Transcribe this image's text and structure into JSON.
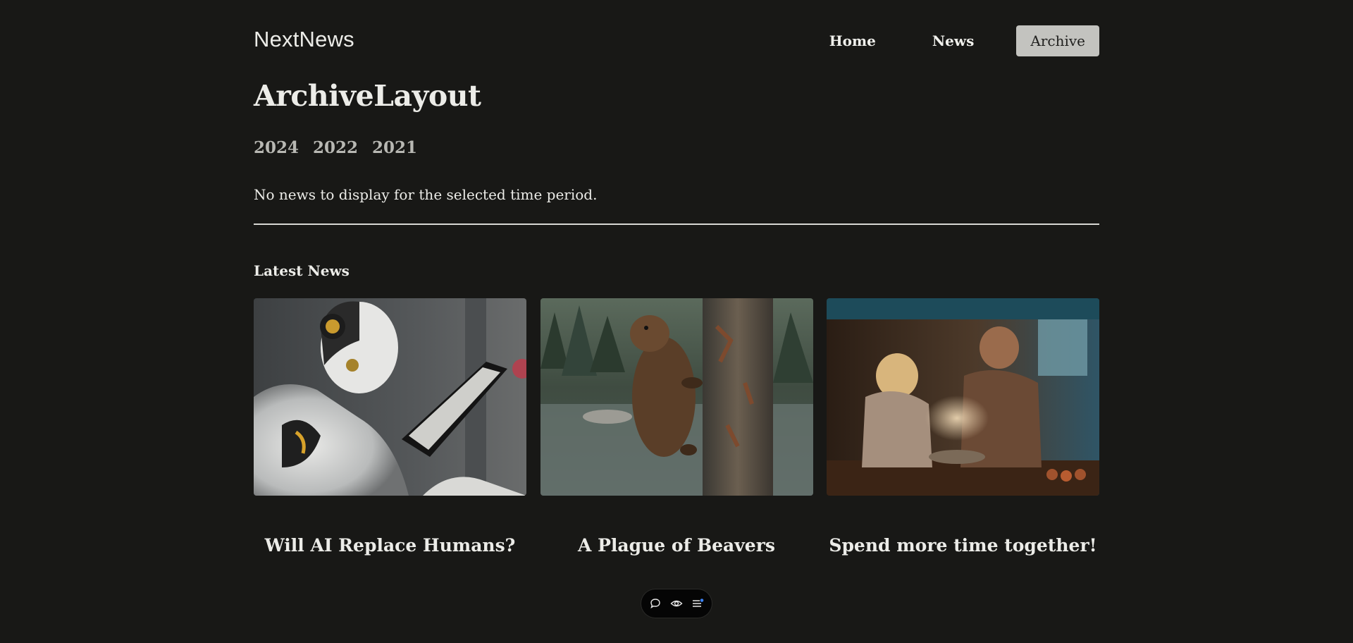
{
  "header": {
    "logo": "NextNews",
    "nav": [
      {
        "label": "Home",
        "active": false
      },
      {
        "label": "News",
        "active": false
      },
      {
        "label": "Archive",
        "active": true
      }
    ]
  },
  "page": {
    "title": "ArchiveLayout",
    "years": [
      "2024",
      "2022",
      "2021"
    ],
    "empty_message": "No news to display for the selected time period."
  },
  "latest": {
    "heading": "Latest News",
    "items": [
      {
        "title": "Will AI Replace Humans?",
        "image": "robot-with-tablet-photo"
      },
      {
        "title": "A Plague of Beavers",
        "image": "beaver-climbing-tree-photo"
      },
      {
        "title": "Spend more time together!",
        "image": "couple-cooking-photo"
      }
    ]
  },
  "toolbar": {
    "icons": [
      "comment-icon",
      "eye-icon",
      "menu-list-icon"
    ],
    "accent": "#3b82f6"
  },
  "colors": {
    "background": "#181816",
    "text": "#ecece8",
    "active_nav_bg": "#c3c3bf"
  }
}
